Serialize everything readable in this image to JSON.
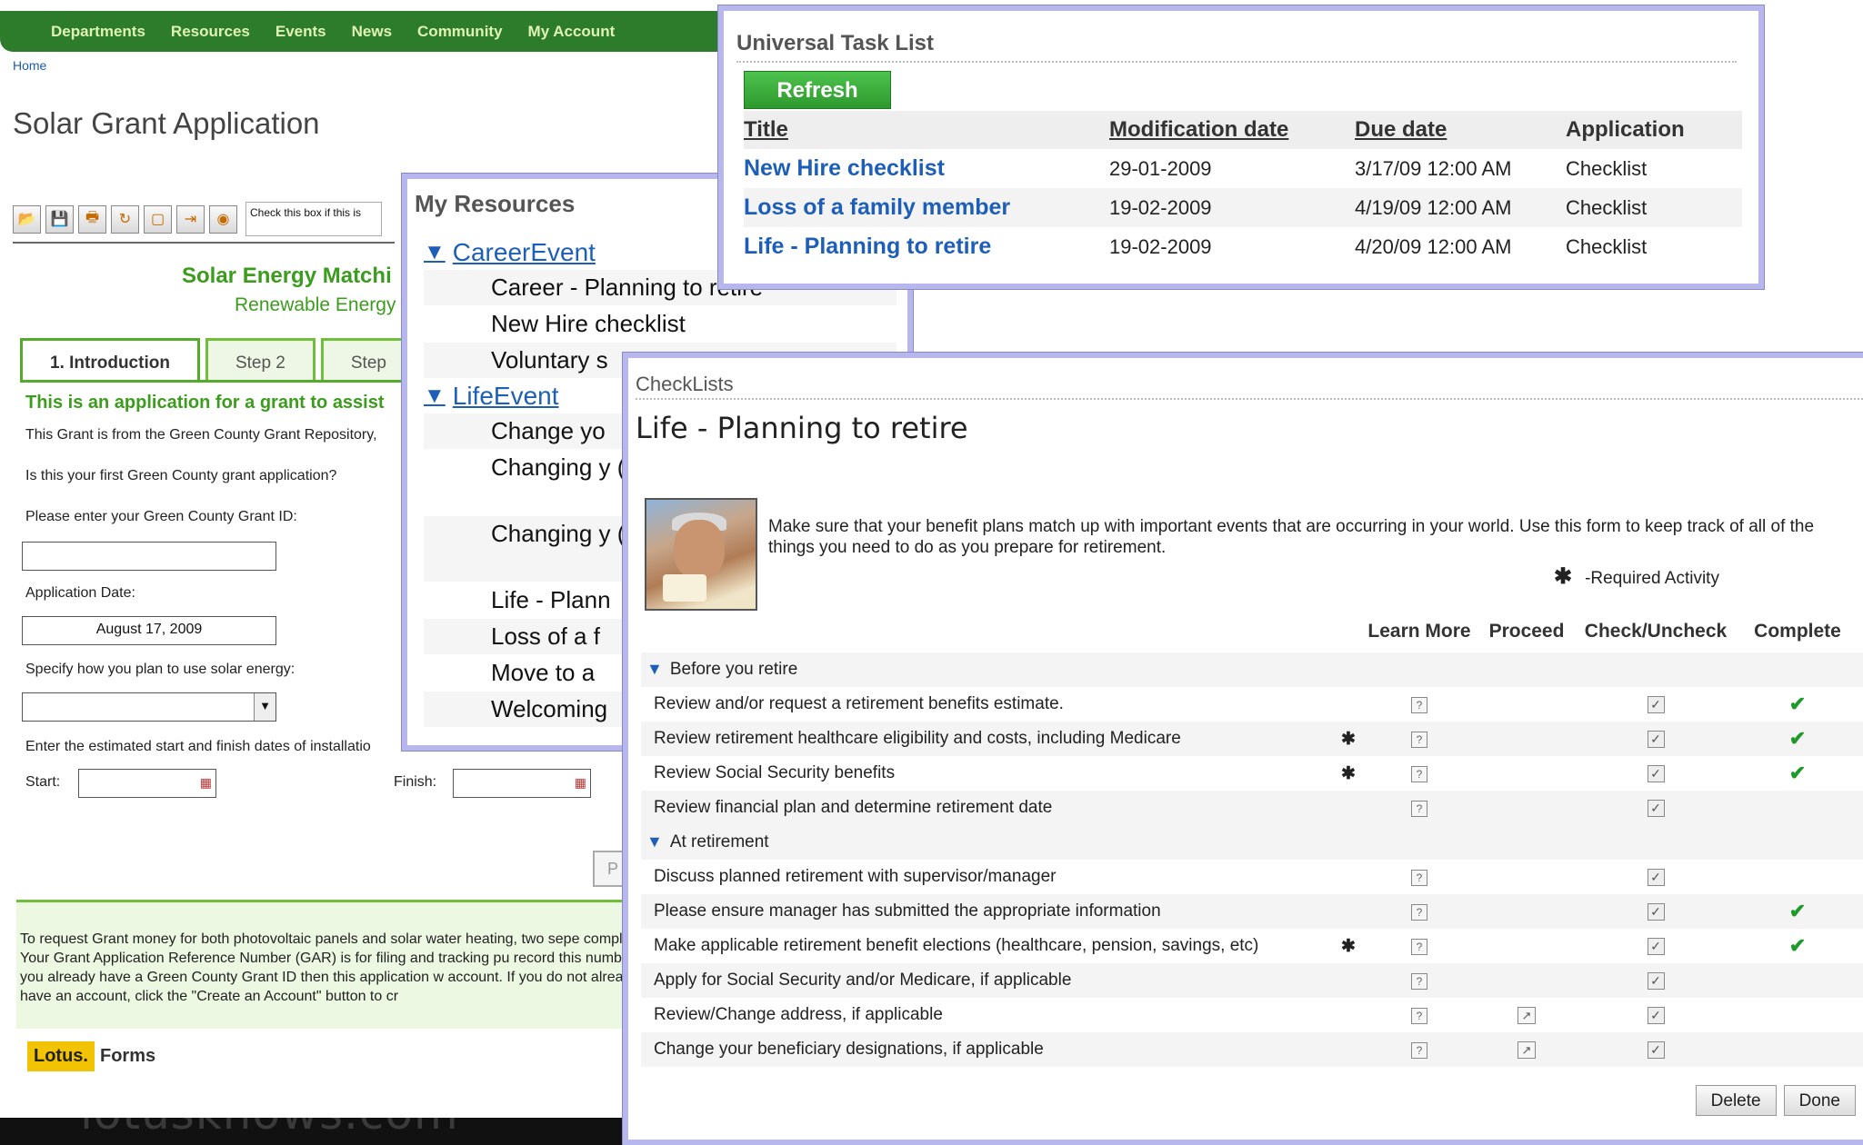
{
  "form_window": {
    "nav": [
      "Departments",
      "Resources",
      "Events",
      "News",
      "Community",
      "My Account"
    ],
    "breadcrumb": "Home",
    "title": "Solar Grant Application",
    "toolbar_checkbox_text": "Check this box if this is",
    "heading": "Solar Energy Matchi",
    "subheading": "Renewable Energy",
    "tabs": [
      "1. Introduction",
      "Step 2",
      "Step"
    ],
    "intro": "This is an application for a grant to assist",
    "grant_repo_text": "This Grant is from the Green County Grant Repository,",
    "first_app_label": "Is this your first Green County grant application?",
    "grant_id_label": "Please enter your Green County Grant ID:",
    "grant_id_value": "",
    "app_date_label": "Application Date:",
    "app_date_value": "August 17, 2009",
    "solar_use_label": "Specify how you plan to use solar energy:",
    "install_dates_label": "Enter the estimated start and finish dates of installatio",
    "start_label": "Start:",
    "finish_label": "Finish:",
    "prev_button": "P",
    "bottom_text": "To request Grant money for both photovoltaic panels and solar water heating, two sepe completed. Your Grant Application Reference Number (GAR) is for filing and tracking pu record this number. If you already have a Green County Grant ID then this application w account. If you do not already have an account, click the \"Create an Account\" button to cr",
    "lotus_badge": "Lotus.",
    "lotus_forms": "Forms",
    "watermark": "lotusknows.com"
  },
  "resources_window": {
    "title": "My Resources",
    "categories": [
      {
        "name": "CareerEvent",
        "items": [
          "Career - Planning to retire",
          "New Hire checklist",
          "Voluntary s"
        ]
      },
      {
        "name": "LifeEvent",
        "items": [
          "Change yo",
          "Changing y (divorce)",
          "Changing y (marriage)",
          "Life - Plann",
          "Loss of a f",
          "Move to a",
          "Welcoming"
        ]
      }
    ]
  },
  "task_window": {
    "title": "Universal Task List",
    "refresh": "Refresh",
    "columns": [
      "Title",
      "Modification date",
      "Due date",
      "Application"
    ],
    "rows": [
      {
        "title": "New Hire checklist",
        "modified": "29-01-2009",
        "due": "3/17/09 12:00 AM",
        "application": "Checklist"
      },
      {
        "title": "Loss of a family member",
        "modified": "19-02-2009",
        "due": "4/19/09 12:00 AM",
        "application": "Checklist"
      },
      {
        "title": "Life - Planning to retire",
        "modified": "19-02-2009",
        "due": "4/20/09 12:00 AM",
        "application": "Checklist"
      }
    ]
  },
  "checklist_window": {
    "title": "CheckLists",
    "heading": "Life - Planning to retire",
    "description": "Make sure that your benefit plans match up with important events that are occurring in your world. Use this form to keep track of all of the things you need to do as you prepare for retirement.",
    "required_legend": "-Required Activity",
    "columns": [
      "Learn More",
      "Proceed",
      "Check/Uncheck",
      "Complete"
    ],
    "sections": [
      {
        "name": "Before you retire",
        "tasks": [
          {
            "text": "Review and/or request a retirement benefits estimate.",
            "required": false,
            "proceed": false,
            "complete": true
          },
          {
            "text": "Review retirement healthcare eligibility and costs, including Medicare",
            "required": true,
            "proceed": false,
            "complete": true
          },
          {
            "text": "Review Social Security benefits",
            "required": true,
            "proceed": false,
            "complete": true
          },
          {
            "text": "Review financial plan and determine retirement date",
            "required": false,
            "proceed": false,
            "complete": false
          }
        ]
      },
      {
        "name": "At retirement",
        "tasks": [
          {
            "text": "Discuss planned retirement with supervisor/manager",
            "required": false,
            "proceed": false,
            "complete": false
          },
          {
            "text": "Please ensure manager has submitted the appropriate information",
            "required": false,
            "proceed": false,
            "complete": true
          },
          {
            "text": "Make applicable retirement benefit elections (healthcare, pension, savings, etc)",
            "required": true,
            "proceed": false,
            "complete": true
          },
          {
            "text": "Apply for Social Security and/or Medicare, if applicable",
            "required": false,
            "proceed": false,
            "complete": false
          },
          {
            "text": "Review/Change address, if applicable",
            "required": false,
            "proceed": true,
            "complete": false
          },
          {
            "text": "Change your beneficiary designations, if applicable",
            "required": false,
            "proceed": true,
            "complete": false
          }
        ]
      }
    ],
    "delete_button": "Delete",
    "done_button": "Done"
  }
}
